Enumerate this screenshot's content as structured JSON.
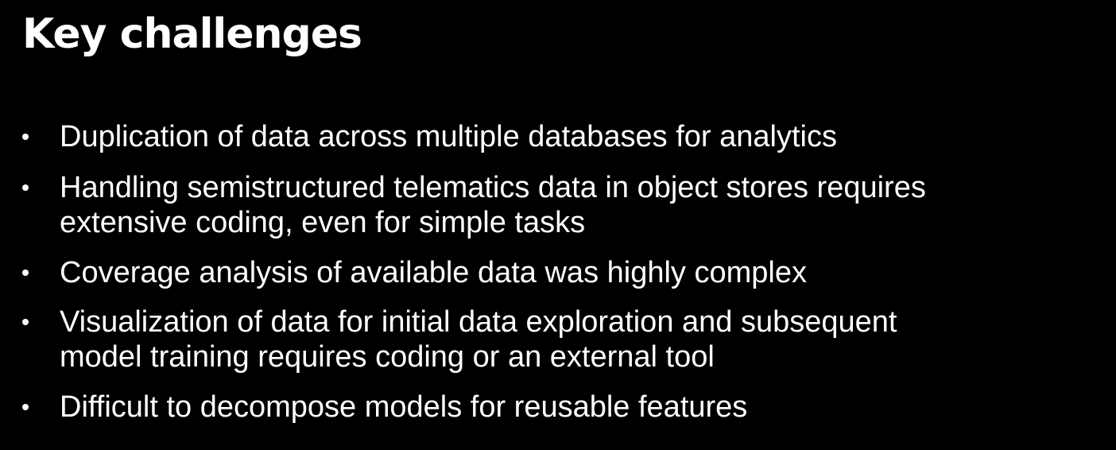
{
  "slide": {
    "title": "Key challenges",
    "bullets": [
      {
        "lines": [
          "Duplication of data across multiple databases for analytics"
        ]
      },
      {
        "lines": [
          "Handling semistructured telematics data in object stores requires",
          "extensive coding, even for simple tasks"
        ]
      },
      {
        "lines": [
          "Coverage analysis of available data was highly complex"
        ]
      },
      {
        "lines": [
          "Visualization of data for initial data exploration and subsequent",
          "model training requires coding or an external tool"
        ]
      },
      {
        "lines": [
          "Difficult to decompose models for reusable features"
        ]
      }
    ]
  },
  "colors": {
    "background": "#000000",
    "text": "#ffffff"
  }
}
